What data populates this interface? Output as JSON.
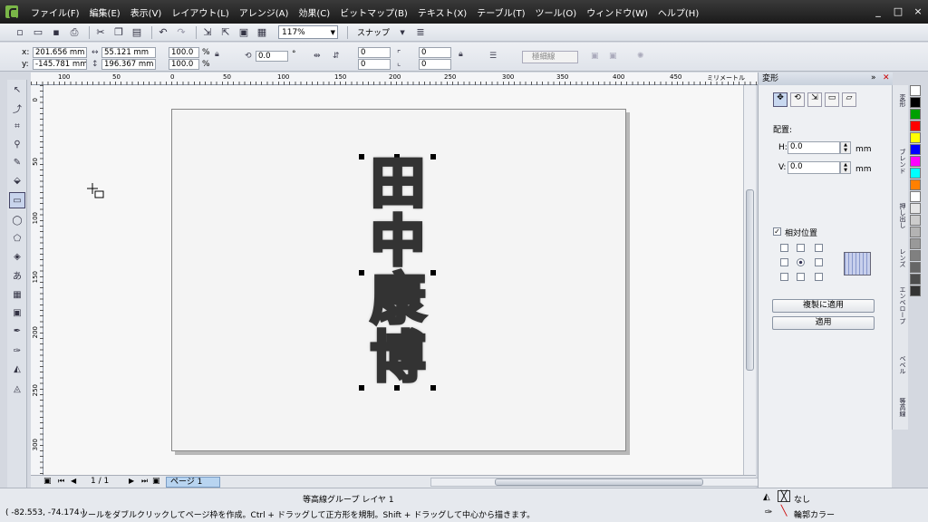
{
  "menubar": {
    "items": [
      "ファイル(F)",
      "編集(E)",
      "表示(V)",
      "レイアウト(L)",
      "アレンジ(A)",
      "効果(C)",
      "ビットマップ(B)",
      "テキスト(X)",
      "テーブル(T)",
      "ツール(O)",
      "ウィンドウ(W)",
      "ヘルプ(H)"
    ],
    "min": "_",
    "max": "□",
    "close": "×"
  },
  "toolbar": {
    "zoom": "117%",
    "snap_label": "スナップ"
  },
  "propbar": {
    "x_label": "x:",
    "x_value": "201.656 mm",
    "y_label": "y:",
    "y_value": "-145.781 mm",
    "w_value": "55.121 mm",
    "h_value": "196.367 mm",
    "scale_x": "100.0",
    "scale_y": "100.0",
    "pct": "%",
    "rotation": "0.0",
    "deg": "°",
    "n1": "0",
    "n2": "0",
    "n3": "0",
    "n4": "0",
    "outline": "極細線"
  },
  "ruler": {
    "h_ticks": [
      "100",
      "50",
      "0",
      "50",
      "100",
      "150",
      "200",
      "250",
      "300",
      "350",
      "400",
      "450"
    ],
    "h_unit": "ミリメートル",
    "v_ticks": [
      "0",
      "50",
      "100",
      "150",
      "200",
      "250",
      "300"
    ],
    "v_unit": "ミリメートル"
  },
  "canvas": {
    "text_chars": [
      "田",
      "中",
      "康",
      "博"
    ]
  },
  "pagenav": {
    "page_count": "1 / 1",
    "page_tab": "ページ 1"
  },
  "status": {
    "object_info": "等高線グループ レイヤ 1",
    "coords": "( -82.553, -74.174 )",
    "hint": "ツールをダブルクリックしてページ枠を作成。Ctrl + ドラッグして正方形を規制。Shift + ドラッグして中心から描きます。",
    "fill_label": "なし",
    "outline_label": "輪郭カラー"
  },
  "docker": {
    "title": "変形",
    "section_label": "配置:",
    "h_label": "H:",
    "h_value": "0.0",
    "h_unit": "mm",
    "v_label": "V:",
    "v_value": "0.0",
    "v_unit": "mm",
    "relative_label": "相対位置",
    "dup_apply": "複製に適用",
    "apply": "適用"
  },
  "side_tabs": [
    "変形",
    "ブレンド",
    "押し出し",
    "レンズ",
    "エンベロープ",
    "ベベル",
    "等高線"
  ],
  "palette_colors": [
    "#ffffff",
    "#000000",
    "#00a000",
    "#ff0000",
    "#ffff00",
    "#0000ff",
    "#ff00ff",
    "#00ffff",
    "#ff8000",
    "#ffffff",
    "#e6e6e6",
    "#cccccc",
    "#b3b3b3",
    "#999999",
    "#808080",
    "#666666",
    "#4d4d4d",
    "#333333"
  ]
}
